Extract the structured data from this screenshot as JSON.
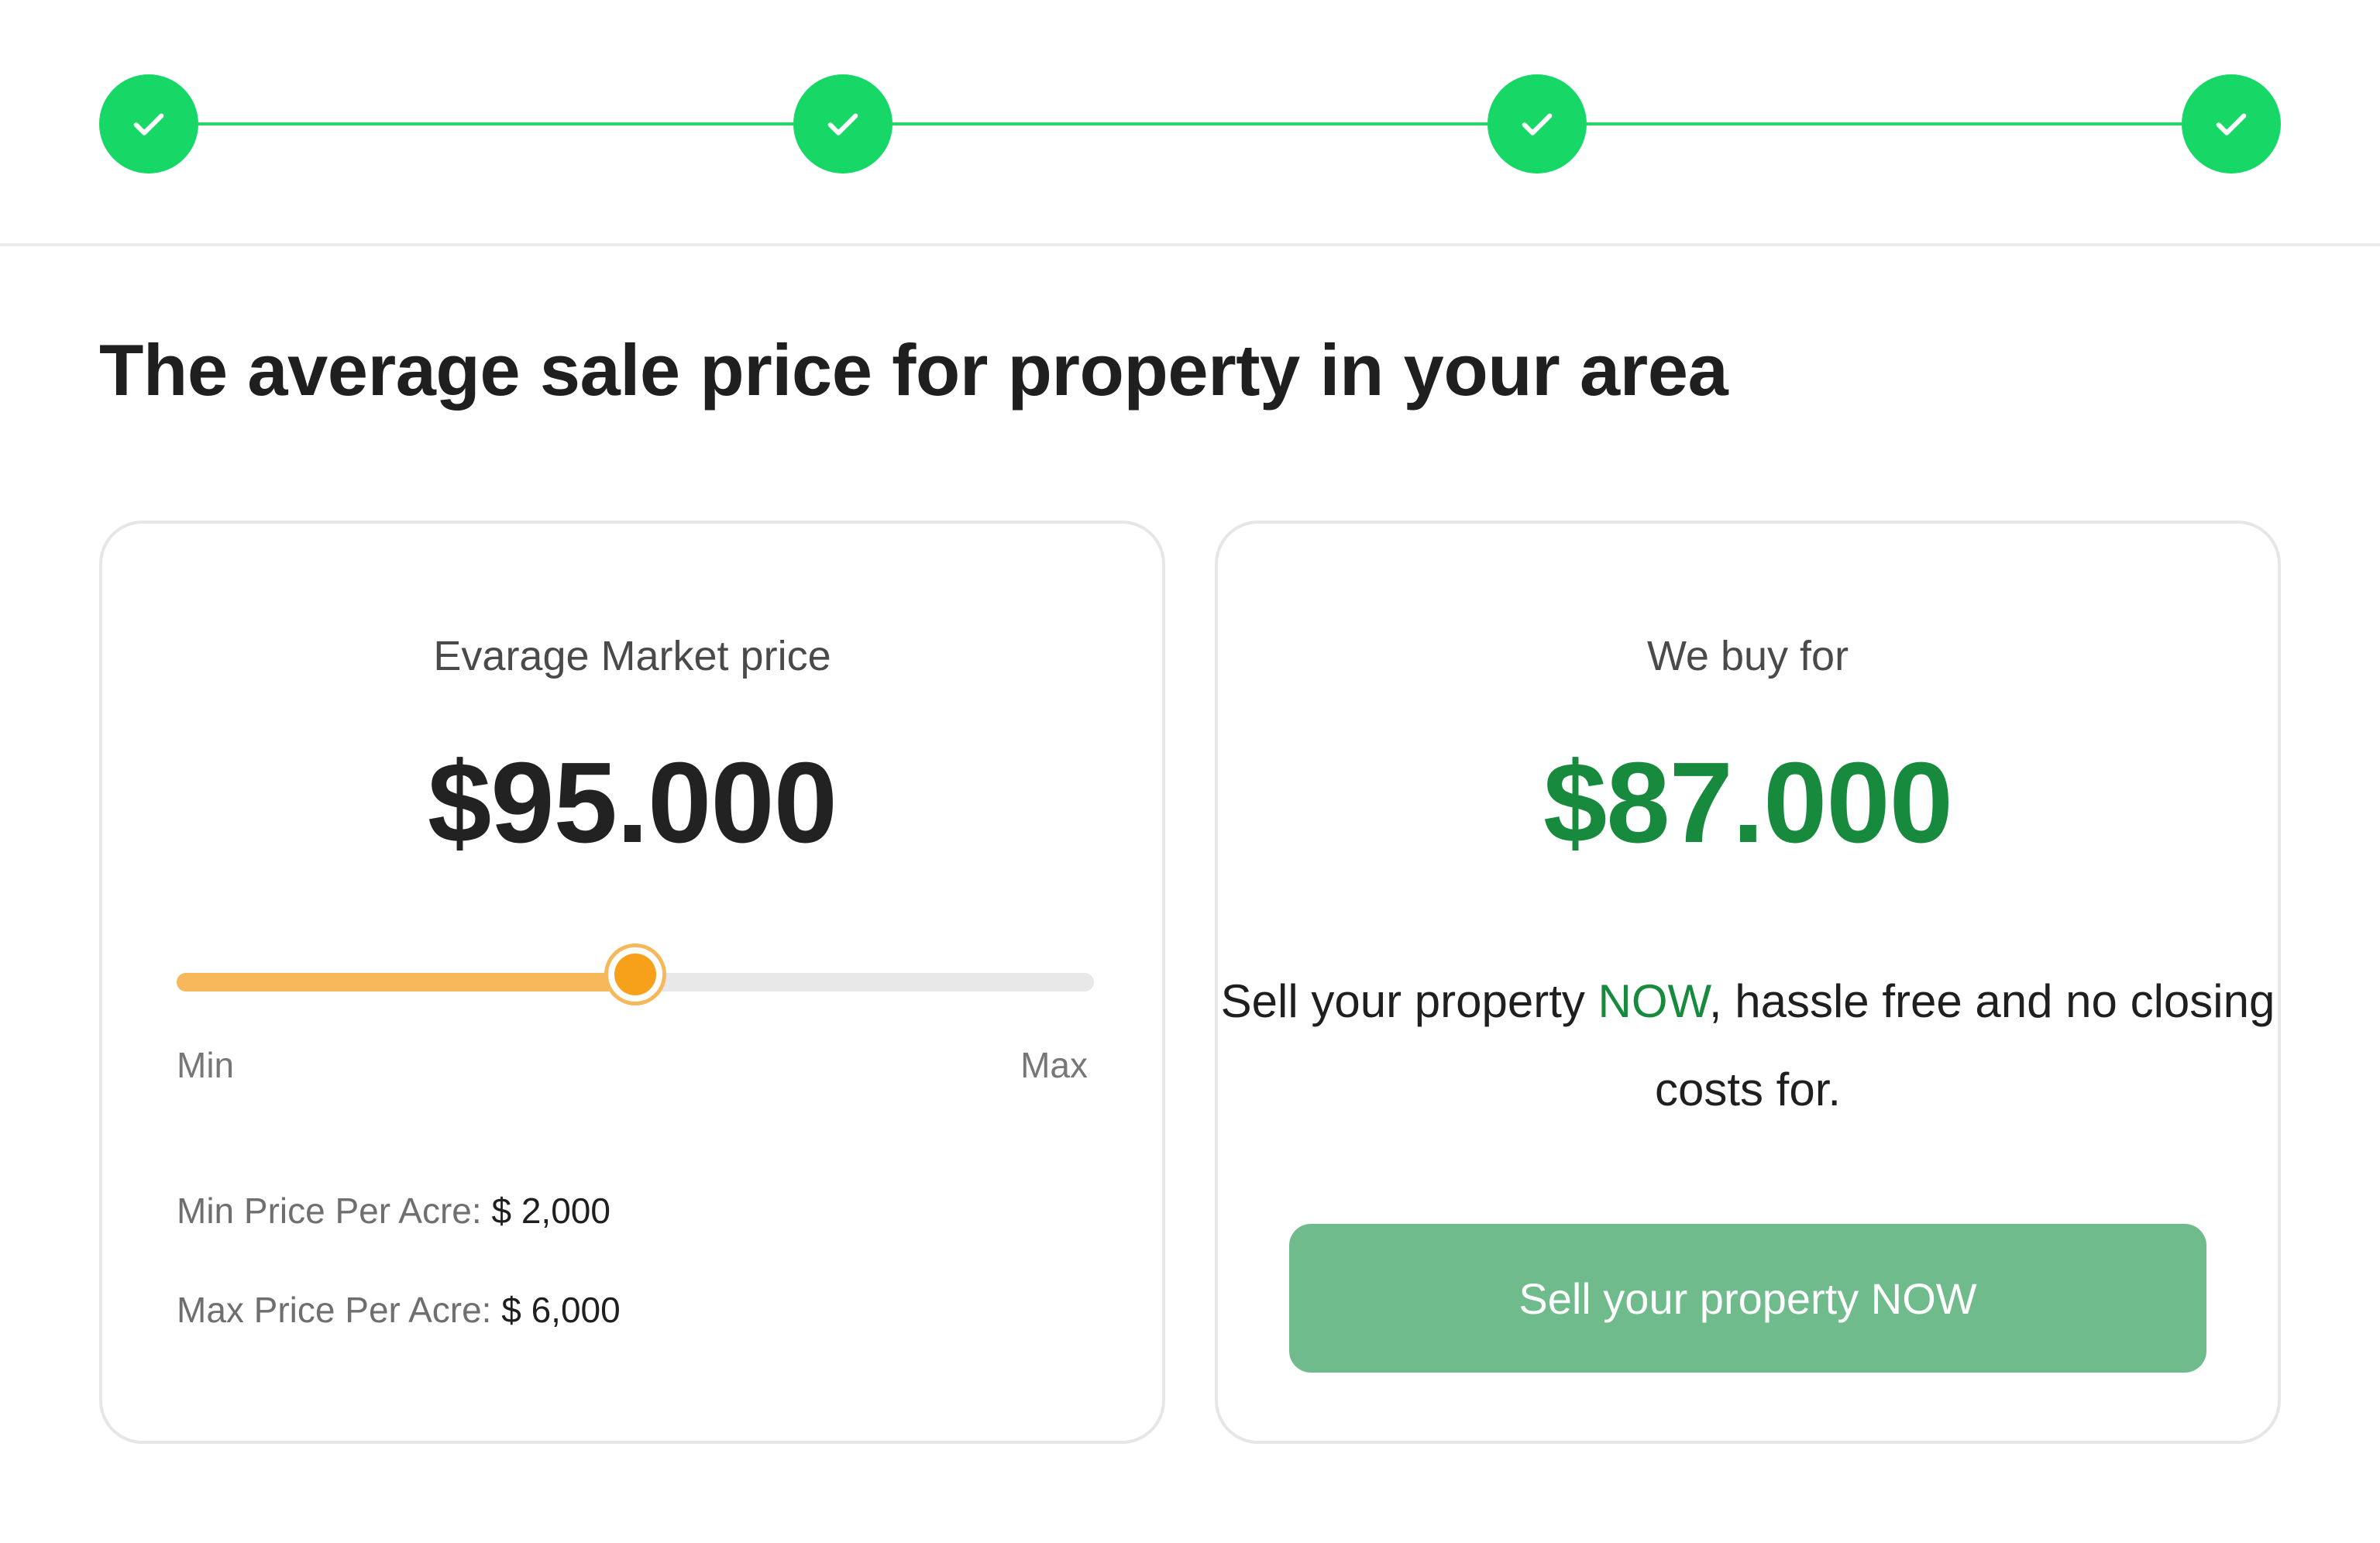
{
  "stepper": {
    "steps": [
      {
        "state": "completed",
        "icon": "check-icon"
      },
      {
        "state": "completed",
        "icon": "check-icon"
      },
      {
        "state": "completed",
        "icon": "check-icon"
      },
      {
        "state": "completed",
        "icon": "check-icon"
      }
    ],
    "color": "#17d866"
  },
  "headline": "The average sale price for property in your area",
  "market_card": {
    "label": "Evarage Market price",
    "price": "$95.000",
    "slider": {
      "min_label": "Min",
      "max_label": "Max",
      "level": 0.5,
      "fill_color": "#f6b85a",
      "thumb_color": "#f7a11a"
    },
    "min_price_label": "Min Price Per Acre:",
    "min_price_value": "$ 2,000",
    "max_price_label": "Max Price Per Acre:",
    "max_price_value": "$ 6,000"
  },
  "offer_card": {
    "label": "We buy for",
    "price": "$87.000",
    "price_color": "#178a3e",
    "pitch_before": "Sell your property ",
    "pitch_accent": "NOW",
    "pitch_after": ", hassle free and no closing costs for.",
    "cta_label": "Sell your property NOW",
    "cta_color": "#6fbb8b"
  }
}
